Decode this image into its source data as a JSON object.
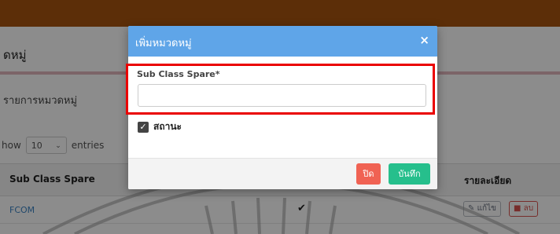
{
  "page": {
    "heading": "ดหมู่",
    "section_title": "รายการหมวดหมู่",
    "show_prefix": "how",
    "entries_value": "10",
    "entries_suffix": "entries",
    "table": {
      "columns": [
        "Sub Class Spare",
        "รายละเอียด"
      ],
      "rows": [
        {
          "code": "FCOM",
          "status_icon": "check-icon",
          "edit_label": "แก้ไข",
          "delete_label": "ลบ"
        }
      ]
    }
  },
  "modal": {
    "title": "เพิ่มหมวดหมู่",
    "close_glyph": "×",
    "field_label": "Sub Class Spare*",
    "field_value": "",
    "status_label": "สถานะ",
    "status_checked": true,
    "buttons": {
      "close": "ปิด",
      "save": "บันทึก"
    }
  },
  "colors": {
    "topbar": "#a8540f",
    "modal_header": "#5fa5e8",
    "close_button": "#f06253",
    "save_button": "#26bf8c",
    "highlight": "#ea0000"
  }
}
